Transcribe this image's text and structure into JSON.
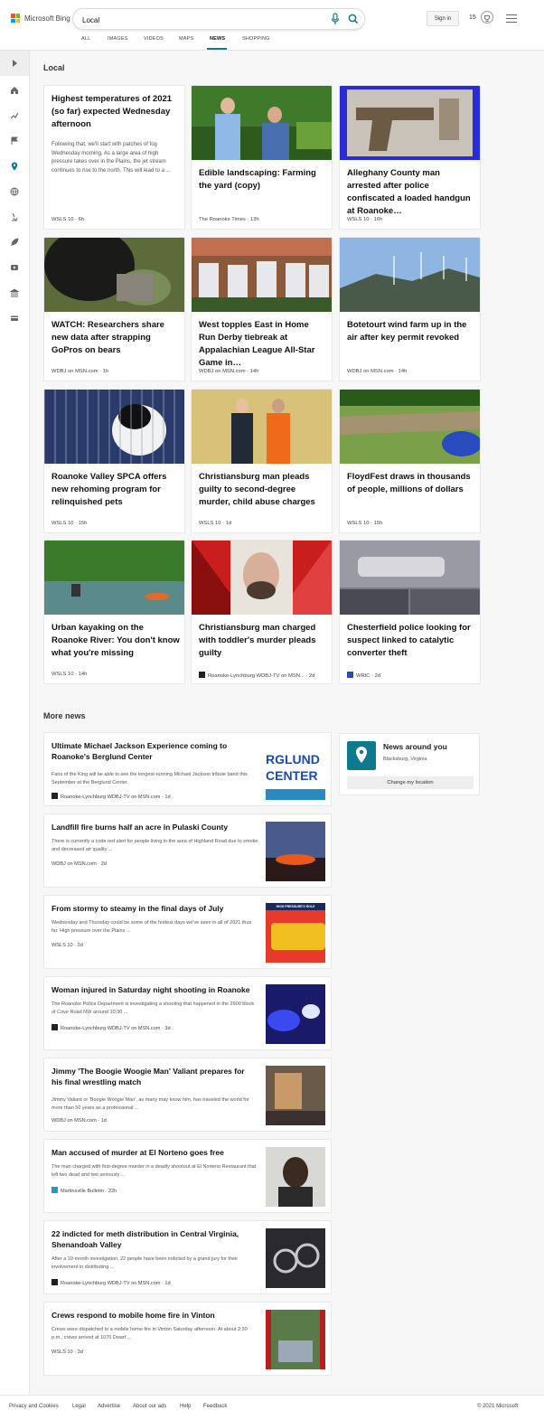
{
  "brand": {
    "name": "Microsoft Bing"
  },
  "search": {
    "value": "Local"
  },
  "header": {
    "sign_in": "Sign in",
    "points": "15"
  },
  "nav_tabs": [
    "ALL",
    "IMAGES",
    "VIDEOS",
    "MAPS",
    "NEWS",
    "SHOPPING"
  ],
  "active_tab": "NEWS",
  "sidebar": {
    "icons": [
      "expand-icon",
      "home-icon",
      "trending-icon",
      "flag-icon",
      "location-icon",
      "globe-icon",
      "science-icon",
      "rocket-icon",
      "video-icon",
      "government-icon",
      "card-icon"
    ]
  },
  "local": {
    "title": "Local",
    "cards": [
      {
        "title": "Highest temperatures of 2021 (so far) expected Wednesday afternoon",
        "snippet": "Following that, we'll start with patches of fog Wednesday morning. As a large area of high pressure takes over in the Plains, the jet stream continues to rise to the north. This will lead to a ...",
        "meta": "WSLS 10 · 6h"
      },
      {
        "title": "Edible landscaping: Farming the yard (copy)",
        "meta": "The Roanoke Times · 13h"
      },
      {
        "title": "Alleghany County man arrested after police confiscated a loaded handgun at Roanoke…",
        "meta": "WSLS 10 · 16h"
      },
      {
        "title": "WATCH: Researchers share new data after strapping GoPros on bears",
        "meta": "WDBJ on MSN.com · 1h"
      },
      {
        "title": "West topples East in Home Run Derby tiebreak at Appalachian League All-Star Game in…",
        "meta": "WDBJ on MSN.com · 14h"
      },
      {
        "title": "Botetourt wind farm up in the air after key permit revoked",
        "meta": "WDBJ on MSN.com · 14h"
      },
      {
        "title": "Roanoke Valley SPCA offers new rehoming program for relinquished pets",
        "meta": "WSLS 10 · 15h"
      },
      {
        "title": "Christiansburg man pleads guilty to second-degree murder, child abuse charges",
        "meta": "WSLS 10 · 1d"
      },
      {
        "title": "FloydFest draws in thousands of people, millions of dollars",
        "meta": "WSLS 10 · 15h"
      },
      {
        "title": "Urban kayaking on the Roanoke River: You don't know what you're missing",
        "meta": "WSLS 10 · 14h"
      },
      {
        "title": "Christiansburg man charged with toddler's murder pleads guilty",
        "meta": "Roanoke-Lynchburg WDBJ-TV on MSN... · 2d"
      },
      {
        "title": "Chesterfield police looking for suspect linked to catalytic converter theft",
        "meta": "WRIC · 2d"
      }
    ]
  },
  "more_news": {
    "title": "More news",
    "items": [
      {
        "title": "Ultimate Michael Jackson Experience coming to Roanoke's Berglund Center",
        "snippet": "Fans of the King will be able to see the longest-running Michael Jackson tribute band this September at the Berglund Center.",
        "meta": "Roanoke-Lynchburg WDBJ-TV on MSN.com · 1d",
        "thumb_text": "RGLUND CENTER"
      },
      {
        "title": "Landfill fire burns half an acre in Pulaski County",
        "snippet": "There is currently a code red alert for people living in the area of Highland Road due to smoke and decreased air quality ...",
        "meta": "WDBJ on MSN.com · 2d"
      },
      {
        "title": "From stormy to steamy in the final days of July",
        "snippet": "Wednesday and Thursday could be some of the hottest days we've seen in all of 2021 thus far. High pressure over the Plains ...",
        "meta": "WSLS 10 · 2d",
        "thumb_text": "HIGH PRESSURE'S ROLE"
      },
      {
        "title": "Woman injured in Saturday night shooting in Roanoke",
        "snippet": "The Roanoke Police Department is investigating a shooting that happened in the 2600 block of Cove Road NW around 10:30 ...",
        "meta": "Roanoke-Lynchburg WDBJ-TV on MSN.com · 3d"
      },
      {
        "title": "Jimmy 'The Boogie Woogie Man' Valiant prepares for his final wrestling match",
        "snippet": "Jimmy Valiant or 'Boogie Woogie Man', as many may know him, has traveled the world for more than 50 years as a professional ...",
        "meta": "WDBJ on MSN.com · 1d"
      },
      {
        "title": "Man accused of murder at El Norteno goes free",
        "snippet": "The man charged with first-degree murder in a deadly shootout at El Norteno Restaurant that left two dead and two seriously ...",
        "meta": "Martinsville Bulletin · 22h"
      },
      {
        "title": "22 indicted for meth distribution in Central Virginia, Shenandoah Valley",
        "snippet": "After a 10-month investigation, 22 people have been indicted by a grand jury for their involvement in distributing ...",
        "meta": "Roanoke-Lynchburg WDBJ-TV on MSN.com · 1d"
      },
      {
        "title": "Crews respond to mobile home fire in Vinton",
        "snippet": "Crews were dispatched to a mobile home fire in Vinton Saturday afternoon. At about 2:30 p.m., crews arrived at 1070 Dwarf ...",
        "meta": "WSLS 10 · 3d"
      }
    ]
  },
  "news_around": {
    "title": "News around you",
    "location": "Blacksburg, Virginia",
    "button": "Change my location"
  },
  "footer": {
    "links": [
      "Privacy and Cookies",
      "Legal",
      "Advertise",
      "About our ads",
      "Help",
      "Feedback"
    ],
    "copyright": "© 2021 Microsoft"
  }
}
